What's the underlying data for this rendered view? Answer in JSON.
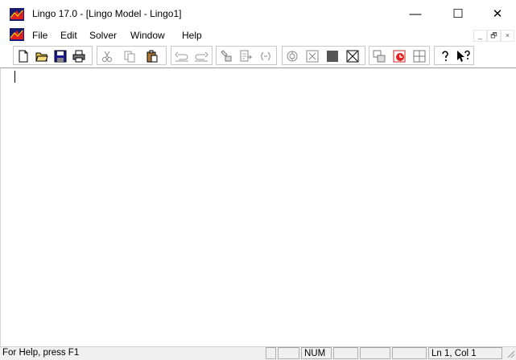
{
  "window": {
    "title": "Lingo 17.0 - [Lingo Model - Lingo1]"
  },
  "window_controls": {
    "minimize": "—",
    "maximize": "☐",
    "close": "✕"
  },
  "menu": {
    "items": [
      "File",
      "Edit",
      "Solver",
      "Window",
      "Help"
    ]
  },
  "mdi_controls": {
    "minimize": "_",
    "restore": "🗗",
    "close": "×"
  },
  "toolbar": {
    "icons": [
      "new-document-icon",
      "open-folder-icon",
      "save-icon",
      "print-icon",
      "cut-icon",
      "copy-icon",
      "paste-icon",
      "undo-icon",
      "redo-icon",
      "find-icon",
      "goto-line-icon",
      "match-parenthesis-icon",
      "solve-icon",
      "solution-icon",
      "stop-icon",
      "close-all-icon",
      "send-to-back-icon",
      "tile-icon",
      "cascade-icon",
      "help-icon",
      "context-help-icon"
    ]
  },
  "statusbar": {
    "help_text": "For Help, press F1",
    "panes": [
      "",
      "",
      "NUM",
      "",
      "",
      "",
      "Ln 1, Col 1"
    ]
  },
  "colors": {
    "window_bg": "#ffffff",
    "statusbar_bg": "#f0f0f0",
    "accent_red": "#cc2222",
    "accent_navy": "#1a1a6e"
  }
}
